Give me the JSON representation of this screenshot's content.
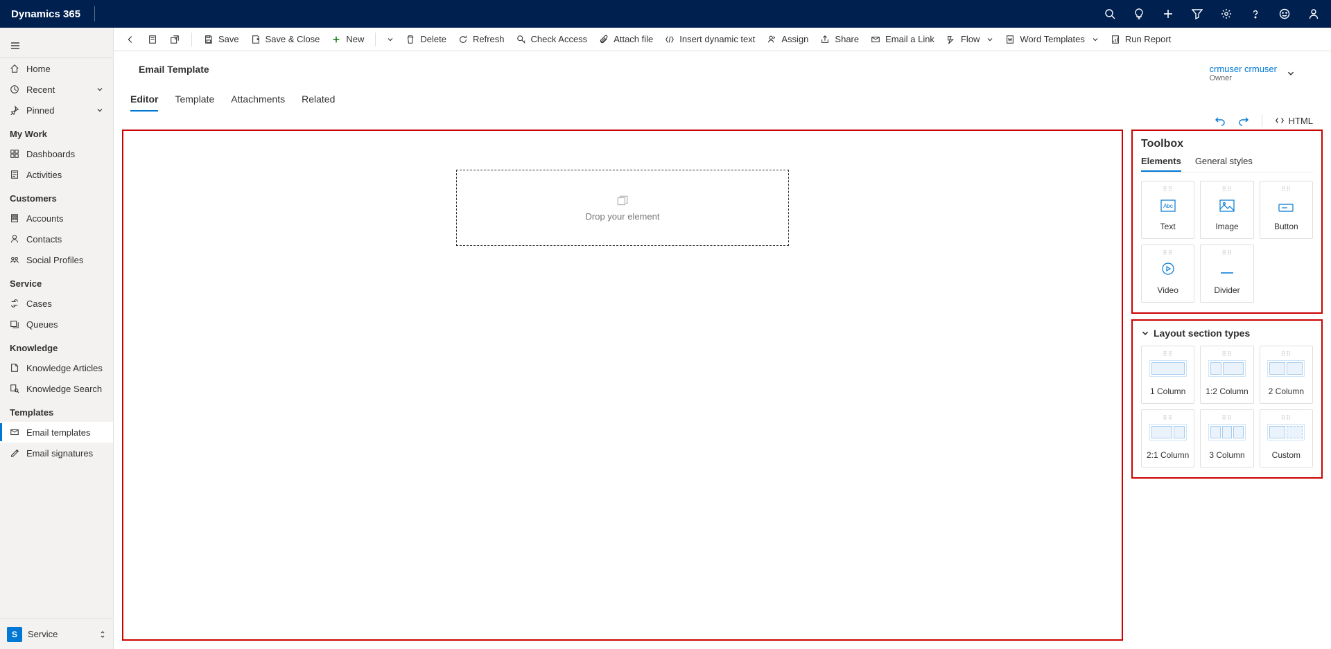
{
  "app_title": "Dynamics 365",
  "sidebar": {
    "top": [
      {
        "icon": "home",
        "label": "Home"
      },
      {
        "icon": "clock",
        "label": "Recent",
        "expandable": true
      },
      {
        "icon": "pin",
        "label": "Pinned",
        "expandable": true
      }
    ],
    "sections": [
      {
        "title": "My Work",
        "items": [
          {
            "icon": "dashboard",
            "label": "Dashboards"
          },
          {
            "icon": "activity",
            "label": "Activities"
          }
        ]
      },
      {
        "title": "Customers",
        "items": [
          {
            "icon": "building",
            "label": "Accounts"
          },
          {
            "icon": "person",
            "label": "Contacts"
          },
          {
            "icon": "social",
            "label": "Social Profiles"
          }
        ]
      },
      {
        "title": "Service",
        "items": [
          {
            "icon": "wrench",
            "label": "Cases"
          },
          {
            "icon": "queue",
            "label": "Queues"
          }
        ]
      },
      {
        "title": "Knowledge",
        "items": [
          {
            "icon": "article",
            "label": "Knowledge Articles"
          },
          {
            "icon": "booksearch",
            "label": "Knowledge Search"
          }
        ]
      },
      {
        "title": "Templates",
        "items": [
          {
            "icon": "emailtpl",
            "label": "Email templates",
            "selected": true
          },
          {
            "icon": "signature",
            "label": "Email signatures"
          }
        ]
      }
    ],
    "area": {
      "badge": "S",
      "label": "Service"
    }
  },
  "commands": {
    "save": "Save",
    "save_close": "Save & Close",
    "new": "New",
    "delete": "Delete",
    "refresh": "Refresh",
    "check_access": "Check Access",
    "attach_file": "Attach file",
    "insert_dynamic": "Insert dynamic text",
    "assign": "Assign",
    "share": "Share",
    "email_link": "Email a Link",
    "flow": "Flow",
    "word_templates": "Word Templates",
    "run_report": "Run Report"
  },
  "record": {
    "title": "Email Template",
    "owner_name": "crmuser crmuser",
    "owner_label": "Owner"
  },
  "tabs": [
    "Editor",
    "Template",
    "Attachments",
    "Related"
  ],
  "editor_controls": {
    "html": "HTML"
  },
  "canvas": {
    "drop_text": "Drop your element"
  },
  "toolbox": {
    "title": "Toolbox",
    "tabs": [
      "Elements",
      "General styles"
    ],
    "elements": [
      "Text",
      "Image",
      "Button",
      "Video",
      "Divider"
    ],
    "layout_title": "Layout section types",
    "layouts": [
      "1 Column",
      "1:2 Column",
      "2 Column",
      "2:1 Column",
      "3 Column",
      "Custom"
    ]
  }
}
